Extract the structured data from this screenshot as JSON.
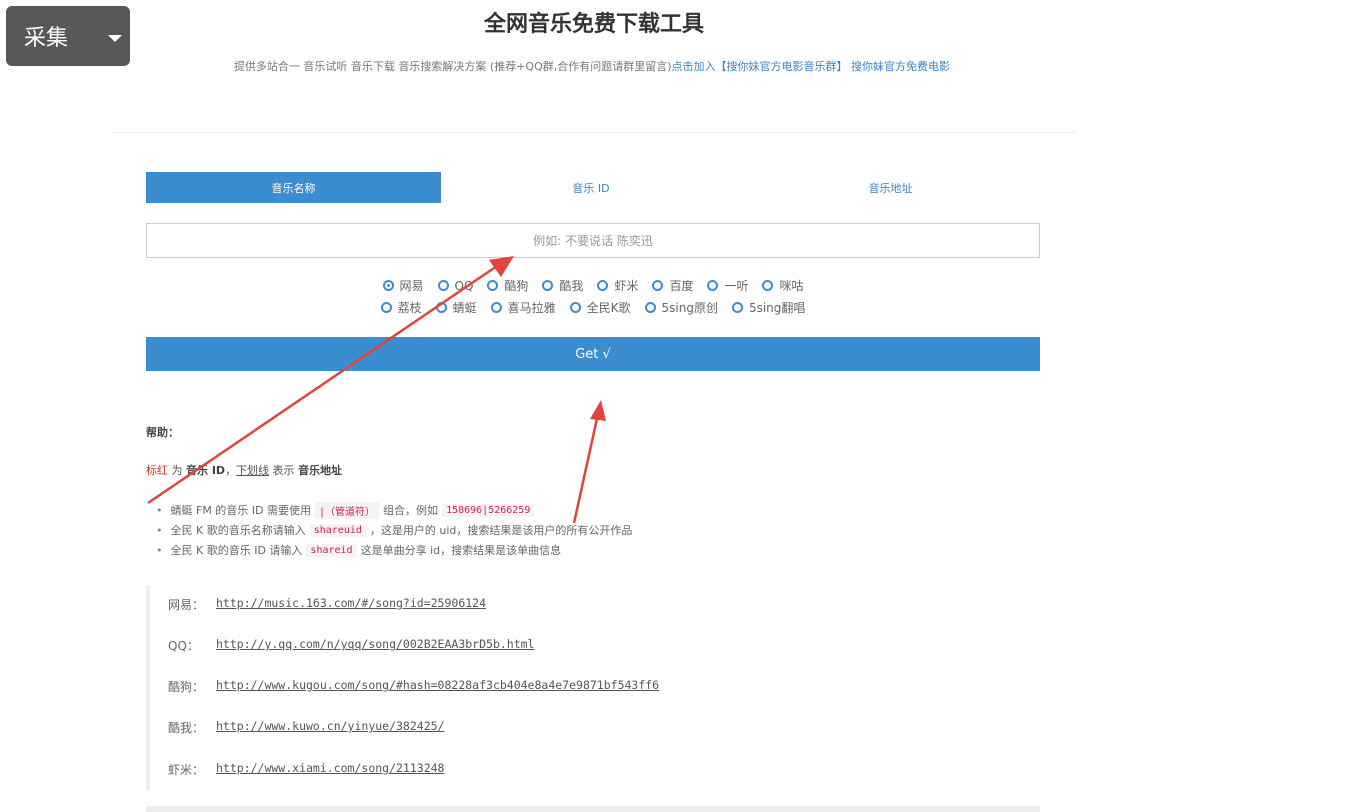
{
  "overlay": {
    "caiji_label": "采集"
  },
  "header": {
    "title": "全网音乐免费下载工具",
    "subtitle": "提供多站合一 音乐试听 音乐下载 音乐搜索解决方案 (推荐+QQ群,合作有问题请群里留言)",
    "link1": "点击加入【搜你妹官方电影音乐群】",
    "link2": "搜你妹官方免费电影"
  },
  "tabs": [
    "音乐名称",
    "音乐 ID",
    "音乐地址"
  ],
  "search": {
    "placeholder": "例如: 不要说话 陈奕迅"
  },
  "sources_row1": [
    "网易",
    "QQ",
    "酷狗",
    "酷我",
    "虾米",
    "百度",
    "一听",
    "咪咕"
  ],
  "sources_row2": [
    "荔枝",
    "蜻蜓",
    "喜马拉雅",
    "全民K歌",
    "5sing原创",
    "5sing翻唱"
  ],
  "selected_source": "网易",
  "get_button": "Get √",
  "help": {
    "title": "帮助：",
    "legend_red": "标红",
    "legend_mid1": " 为 ",
    "legend_id": "音乐 ID",
    "legend_sep": "，",
    "legend_u": "下划线",
    "legend_mid2": " 表示 ",
    "legend_url": "音乐地址",
    "b1_pre": "蜻蜓 FM 的音乐 ID 需要使用",
    "b1_code1": "|（管道符）",
    "b1_mid": "组合，例如",
    "b1_code2": "158696|5266259",
    "b2_pre": "全民 K 歌的音乐名称请输入",
    "b2_code": "shareuid",
    "b2_post": "，这是用户的 uid，搜索结果是该用户的所有公开作品",
    "b3_pre": "全民 K 歌的音乐 ID 请输入",
    "b3_code": "shareid",
    "b3_post": "这是单曲分享 id，搜索结果是该单曲信息"
  },
  "examples": [
    {
      "label": "网易：",
      "url": "http://music.163.com/#/song?id=25906124"
    },
    {
      "label": "QQ：",
      "url": "http://y.qq.com/n/yqq/song/002B2EAA3brD5b.html"
    },
    {
      "label": "酷狗：",
      "url": "http://www.kugou.com/song/#hash=08228af3cb404e8a4e7e9871bf543ff6"
    },
    {
      "label": "酷我：",
      "url": "http://www.kuwo.cn/yinyue/382425/"
    },
    {
      "label": "虾米：",
      "url": "http://www.xiami.com/song/2113248"
    }
  ],
  "colors": {
    "accent": "#3c8dd0",
    "arrow": "#e0443a"
  }
}
